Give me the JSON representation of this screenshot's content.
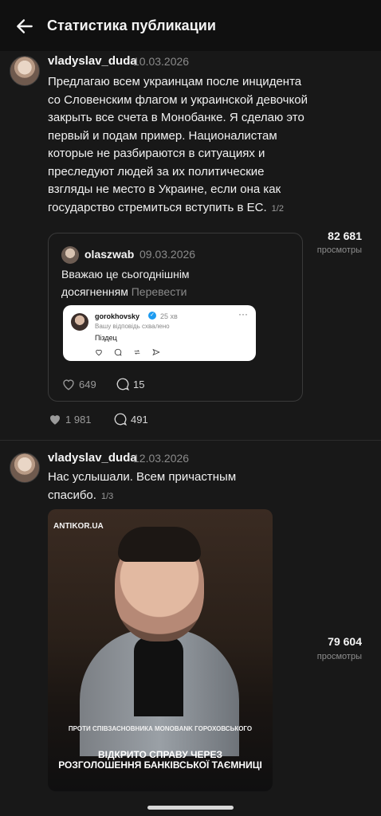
{
  "header": {
    "title": "Статистика публикации"
  },
  "post1": {
    "username": "vladyslav_duda",
    "date": "10.03.2026",
    "text": "Предлагаю всем украинцам после инцидента со Словенским флагом и украинской девочкой закрыть все счета в Монобанке. Я сделаю это первый и подам пример. Националистам которые не разбираются в ситуациях и преследуют людей за их политические взгляды не место в Украине, если она как государство стремиться вступить в ЕС.",
    "pager": "1/2",
    "views": "82 681",
    "views_label": "просмотры",
    "likes": "1 981",
    "replies": "491",
    "quote": {
      "username": "olaszwab",
      "date": "09.03.2026",
      "text": "Вважаю це сьогоднішнім досягненням",
      "translate": "Перевести",
      "likes": "649",
      "replies": "15",
      "screenshot": {
        "username": "gorokhovsky",
        "time": "25 хв",
        "subtitle": "Вашу відповідь схвалено",
        "text": "Піздец"
      }
    }
  },
  "post2": {
    "username": "vladyslav_duda",
    "date": "12.03.2026",
    "text": "Нас услышали. Всем причастным спасибо.",
    "pager": "1/3",
    "views": "79 604",
    "views_label": "просмотры",
    "image": {
      "brand": "ANTIKOR.UA",
      "caption_sub": "ПРОТИ СПІВЗАСНОВНИКА MONOBANK ГОРОХОВСЬКОГО",
      "caption_main": "ВІДКРИТО СПРАВУ ЧЕРЕЗ РОЗГОЛОШЕННЯ БАНКІВСЬКОЇ ТАЄМНИЦІ"
    }
  },
  "colors": {
    "background": "#181818",
    "topbar": "#101010",
    "muted": "#8a8a8a"
  }
}
